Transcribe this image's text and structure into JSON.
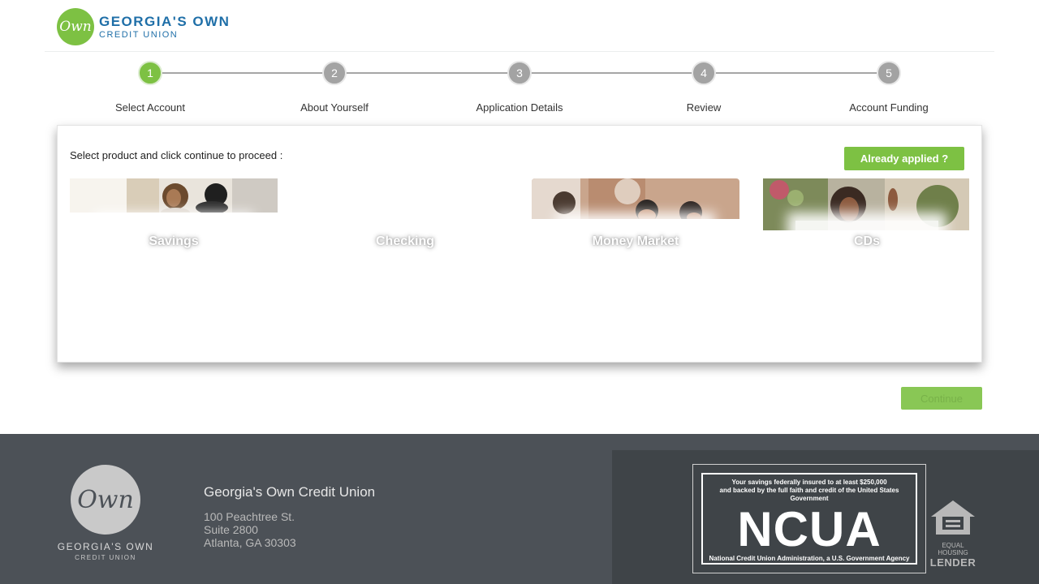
{
  "header": {
    "logo_mark": "Own",
    "logo_line1": "GEORGIA'S OWN",
    "logo_line2": "CREDIT UNION"
  },
  "stepper": {
    "steps": [
      {
        "number": "1",
        "label": "Select Account",
        "active": true
      },
      {
        "number": "2",
        "label": "About Yourself",
        "active": false
      },
      {
        "number": "3",
        "label": "Application Details",
        "active": false
      },
      {
        "number": "4",
        "label": "Review",
        "active": false
      },
      {
        "number": "5",
        "label": "Account Funding",
        "active": false
      }
    ]
  },
  "panel": {
    "instruction": "Select product and click continue to proceed :",
    "already_applied_label": "Already applied ?",
    "products": [
      {
        "label": "Savings"
      },
      {
        "label": "Checking"
      },
      {
        "label": "Money Market"
      },
      {
        "label": "CDs"
      }
    ]
  },
  "continue_label": "Continue",
  "colors": {
    "accent_green": "#7dc143",
    "brand_blue": "#1f6fa8",
    "footer_bg": "#4c5157"
  },
  "footer": {
    "logo_mark": "Own",
    "logo_line1": "GEORGIA'S OWN",
    "logo_line2": "CREDIT UNION",
    "org_name": "Georgia's Own Credit Union",
    "address_line1": "100 Peachtree St.",
    "address_line2": "Suite 2800",
    "address_line3": "Atlanta, GA 30303",
    "ncua_top_line1": "Your savings federally insured to at least $250,000",
    "ncua_top_line2": "and backed by the full faith and credit of the United States Government",
    "ncua_big": "NCUA",
    "ncua_bottom": "National Credit Union Administration, a U.S. Government Agency",
    "ehl_line1": "EQUAL HOUSING",
    "ehl_line2": "LENDER"
  }
}
